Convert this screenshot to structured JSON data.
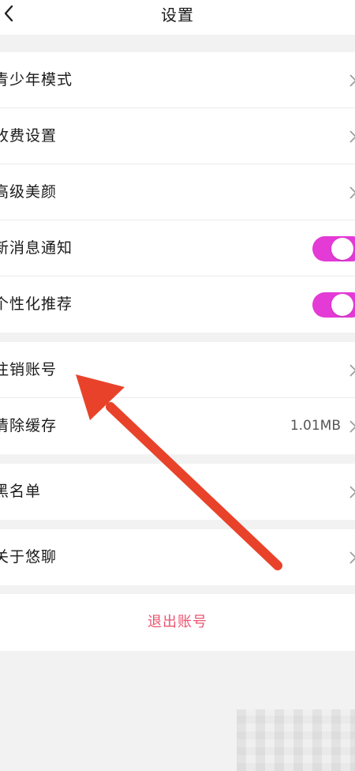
{
  "header": {
    "title": "设置",
    "back_icon": "chevron-left-icon"
  },
  "section_1": {
    "items": [
      {
        "label": "青少年模式"
      },
      {
        "label": "收费设置"
      },
      {
        "label": "高级美颜"
      },
      {
        "label": "新消息通知",
        "toggle": true
      },
      {
        "label": "个性化推荐",
        "toggle": true
      }
    ]
  },
  "section_2": {
    "items": [
      {
        "label": "注销账号"
      },
      {
        "label": "清除缓存",
        "value": "1.01MB"
      }
    ]
  },
  "section_3": {
    "items": [
      {
        "label": "黑名单"
      }
    ]
  },
  "section_4": {
    "items": [
      {
        "label": "关于悠聊"
      }
    ]
  },
  "logout": {
    "label": "退出账号"
  },
  "colors": {
    "toggle_on": "#e43ad6",
    "logout_text": "#e85470",
    "annotation_arrow": "#e8432a",
    "page_background": "#f2f2f3"
  }
}
